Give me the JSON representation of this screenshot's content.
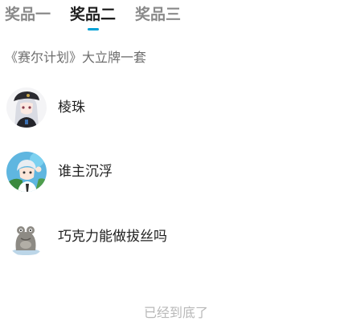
{
  "tabs": [
    {
      "label": "奖品一",
      "active": false
    },
    {
      "label": "奖品二",
      "active": true
    },
    {
      "label": "奖品三",
      "active": false
    }
  ],
  "accent_color": "#00a1d6",
  "prize": {
    "title": "《赛尔计划》大立牌一套"
  },
  "winners": [
    {
      "name": "棱珠",
      "avatar": "avatar-silver-haired-girl-in-beret"
    },
    {
      "name": "谁主沉浮",
      "avatar": "avatar-white-haired-boy-waving"
    },
    {
      "name": "巧克力能做拔丝吗",
      "avatar": "avatar-grey-frog-figure"
    }
  ],
  "footer": {
    "end_text": "已经到底了"
  }
}
